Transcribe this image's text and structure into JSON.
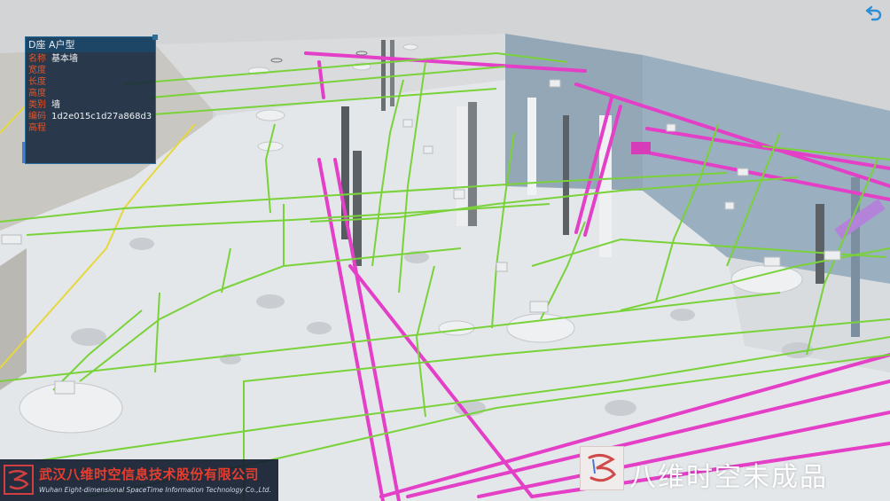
{
  "panel": {
    "title": "D座  A户型",
    "rows": [
      {
        "label": "名称",
        "value": "基本墙"
      },
      {
        "label": "宽度",
        "value": ""
      },
      {
        "label": "长度",
        "value": ""
      },
      {
        "label": "高度",
        "value": ""
      },
      {
        "label": "类别",
        "value": "墙"
      },
      {
        "label": "编码",
        "value": "1d2e015c1d27a868d39d"
      },
      {
        "label": "高程",
        "value": ""
      }
    ]
  },
  "company": {
    "name_cn": "武汉八维时空信息技术股份有限公司",
    "name_en": "Wuhan Eight-dimensional SpaceTime Information Technology Co.,Ltd."
  },
  "watermark": {
    "text": "八维时空未成品"
  },
  "icons": {
    "back": "back-arrow-icon",
    "logo": "company-logo-icon"
  },
  "colors": {
    "pipe_green": "#7ed63a",
    "pipe_magenta": "#e63cc6",
    "floor": "#e3e6e8",
    "wall_blue": "#8fa6b8",
    "panel_bg": "#12263a",
    "label_red": "#e0542c",
    "accent_blue": "#2b8fd8"
  }
}
